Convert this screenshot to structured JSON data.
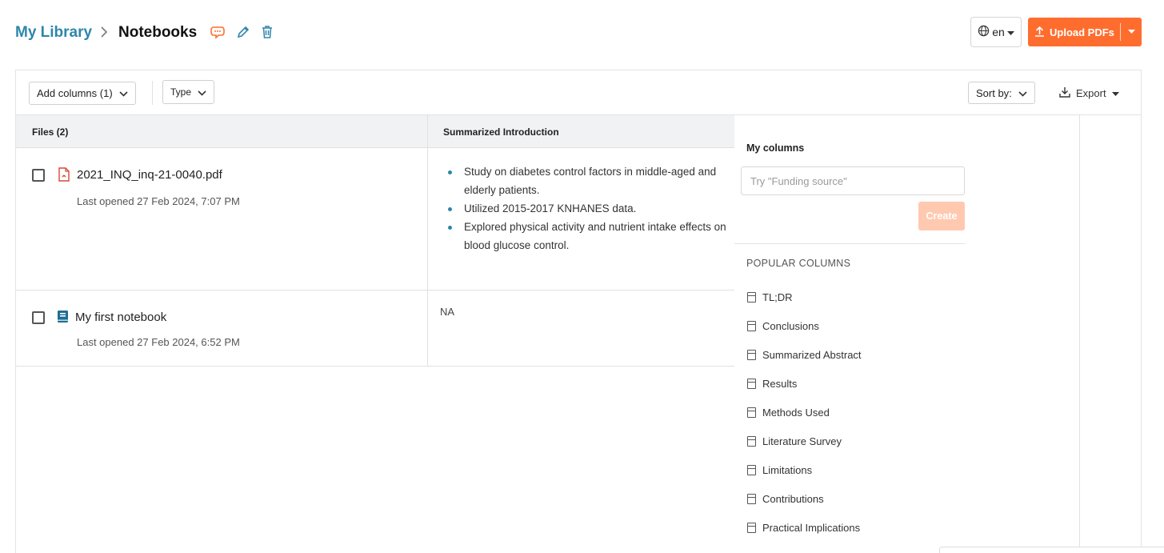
{
  "header": {
    "breadcrumb_root": "My Library",
    "breadcrumb_current": "Notebooks",
    "language": "en",
    "upload_label": "Upload PDFs"
  },
  "toolbar": {
    "add_columns_label": "Add columns (1)",
    "type_label": "Type",
    "sort_label": "Sort by:",
    "export_label": "Export"
  },
  "table": {
    "columns": [
      "Files (2)",
      "Summarized Introduction"
    ],
    "rows": [
      {
        "name": "2021_INQ_inq-21-0040.pdf",
        "meta": "Last opened 27 Feb 2024, 7:07 PM",
        "icon": "pdf-file-icon",
        "summary": [
          "Study on diabetes control factors in middle-aged and elderly patients.",
          "Utilized 2015-2017 KNHANES data.",
          "Explored physical activity and nutrient intake effects on blood glucose control."
        ]
      },
      {
        "name": "My first notebook",
        "meta": "Last opened 27 Feb 2024, 6:52 PM",
        "icon": "notebook-icon",
        "summary_text": "NA"
      }
    ]
  },
  "column_picker": {
    "title": "My columns",
    "placeholder": "Try \"Funding source\"",
    "create_label": "Create",
    "popular_title": "POPULAR COLUMNS",
    "popular_items": [
      "TL;DR",
      "Conclusions",
      "Summarized Abstract",
      "Results",
      "Methods Used",
      "Literature Survey",
      "Limitations",
      "Contributions",
      "Practical Implications"
    ]
  },
  "colors": {
    "accent_blue": "#2e86ab",
    "upload_orange": "#ff6d2e",
    "create_disabled": "#ffc9b0",
    "pdf_red": "#d9473a"
  }
}
